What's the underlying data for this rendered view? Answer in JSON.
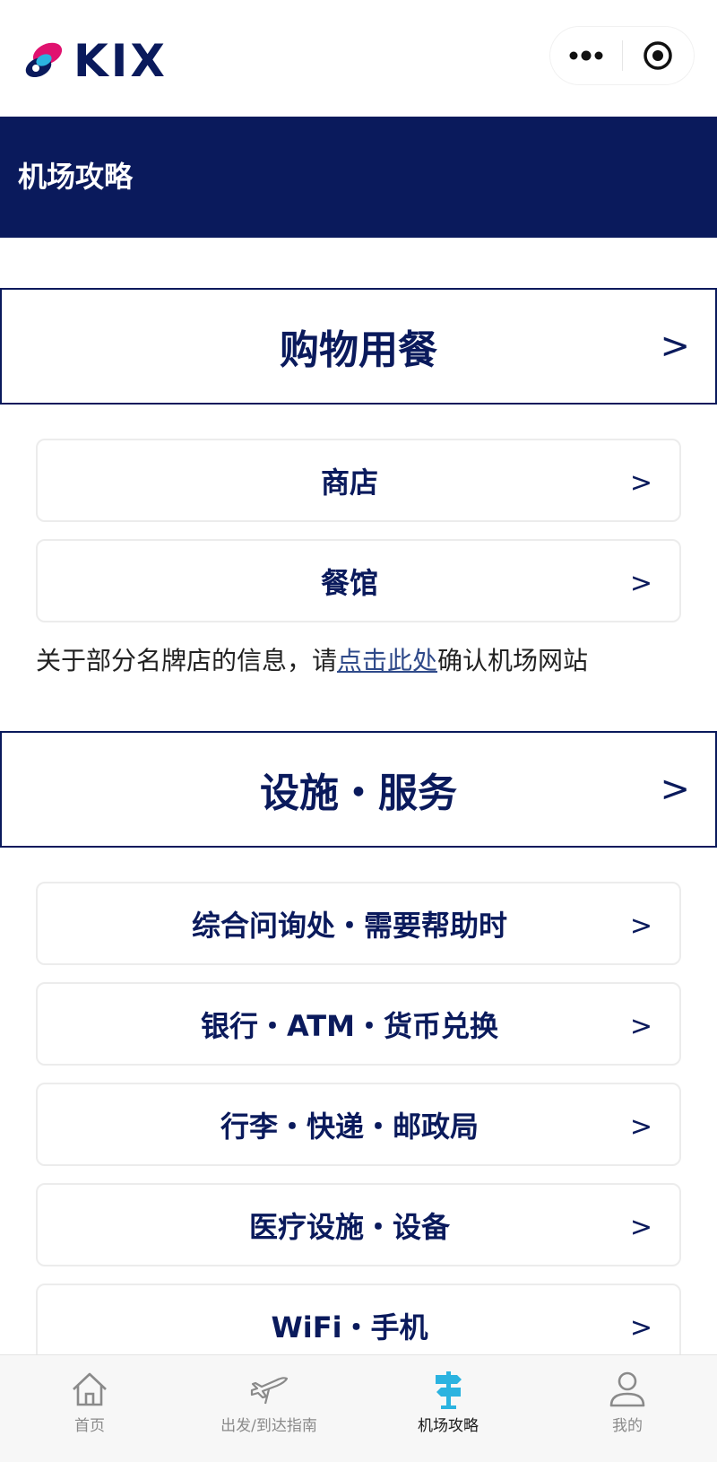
{
  "header": {
    "logo_text": "KIX",
    "more_icon": "more-dots-icon",
    "close_icon": "target-circle-icon"
  },
  "banner": {
    "title": "机场攻略"
  },
  "sections": [
    {
      "title": "购物用餐",
      "chevron": ">",
      "items": [
        {
          "label": "商店",
          "chevron": ">"
        },
        {
          "label": "餐馆",
          "chevron": ">"
        }
      ],
      "note": {
        "prefix": "关于部分名牌店的信息，请",
        "link": "点击此处",
        "suffix": "确认机场网站"
      }
    },
    {
      "title": "设施・服务",
      "chevron": ">",
      "items": [
        {
          "label": "综合问询处・需要帮助时",
          "chevron": ">"
        },
        {
          "label": "银行・ATM・货币兑换",
          "chevron": ">"
        },
        {
          "label": "行李・快递・邮政局",
          "chevron": ">"
        },
        {
          "label": "医疗设施・设备",
          "chevron": ">"
        },
        {
          "label": "WiFi・手机",
          "chevron": ">"
        }
      ]
    }
  ],
  "tabbar": {
    "tabs": [
      {
        "label": "首页",
        "icon": "home-icon",
        "active": false
      },
      {
        "label": "出发/到达指南",
        "icon": "airplane-icon",
        "active": false
      },
      {
        "label": "机场攻略",
        "icon": "signpost-icon",
        "active": true
      },
      {
        "label": "我的",
        "icon": "person-icon",
        "active": false
      }
    ]
  },
  "colors": {
    "navy": "#0a1a5c",
    "accent": "#2bb3e0",
    "link": "#2f4a8a"
  }
}
